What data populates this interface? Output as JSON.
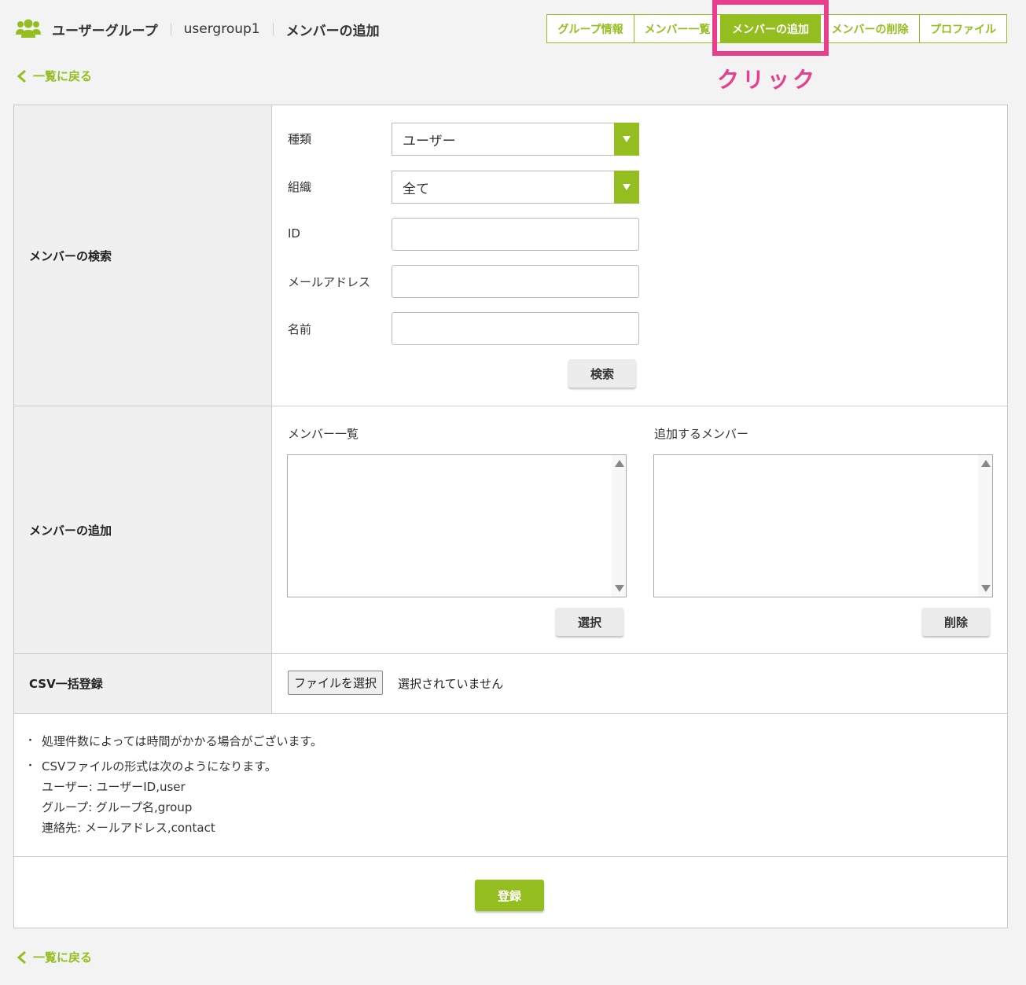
{
  "breadcrumb": {
    "section": "ユーザーグループ",
    "group": "usergroup1",
    "page": "メンバーの追加"
  },
  "tabs": [
    {
      "label": "グループ情報",
      "active": false
    },
    {
      "label": "メンバー一覧",
      "active": false
    },
    {
      "label": "メンバーの追加",
      "active": true
    },
    {
      "label": "メンバーの削除",
      "active": false
    },
    {
      "label": "プロファイル",
      "active": false
    }
  ],
  "annotation": {
    "label": "クリック",
    "color": "#e83e8c"
  },
  "back_link": "一覧に戻る",
  "search": {
    "label": "メンバーの検索",
    "type_label": "種類",
    "type_value": "ユーザー",
    "org_label": "組織",
    "org_value": "全て",
    "id_label": "ID",
    "id_value": "",
    "email_label": "メールアドレス",
    "email_value": "",
    "name_label": "名前",
    "name_value": "",
    "button": "検索"
  },
  "add": {
    "label": "メンバーの追加",
    "list_label": "メンバー一覧",
    "target_label": "追加するメンバー",
    "select_button": "選択",
    "delete_button": "削除"
  },
  "csv": {
    "label": "CSV一括登録",
    "file_button": "ファイルを選択",
    "file_status": "選択されていません"
  },
  "notes": {
    "line1": "処理件数によっては時間がかかる場合がございます。",
    "line2": "CSVファイルの形式は次のようになります。",
    "line3": "ユーザー: ユーザーID,user",
    "line4": "グループ: グループ名,group",
    "line5": "連絡先: メールアドレス,contact"
  },
  "submit": "登録",
  "colors": {
    "accent": "#94be1f",
    "highlight": "#e83e8c"
  }
}
